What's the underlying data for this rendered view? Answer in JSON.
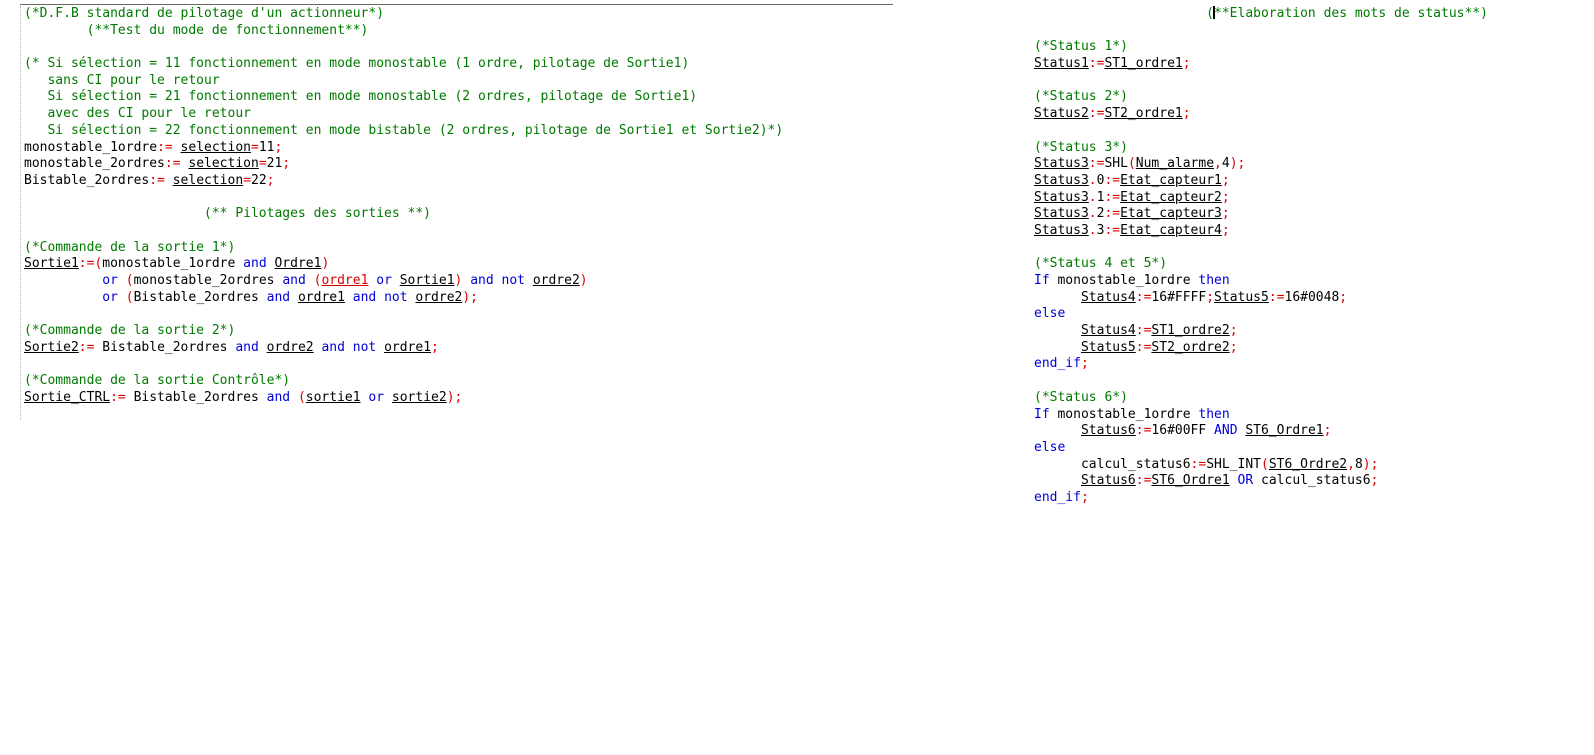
{
  "editor": {
    "name": "structured-text-editor",
    "panes": [
      {
        "id": "left",
        "title": "D.F.B standard de pilotage d'un actionneur"
      },
      {
        "id": "right",
        "title": "Elaboration des mots de status"
      }
    ],
    "colors": {
      "comment": "#007a00",
      "keyword": "#0000dd",
      "operator": "#dd0000",
      "identifier": "#000000",
      "background": "#ffffff",
      "rule": "#6b6b62",
      "gutter": "#b5b5b5"
    }
  },
  "left_pane": {
    "lines": [
      [
        {
          "t": "(*D.F.B standard de pilotage d'un actionneur*)",
          "c": "cm"
        }
      ],
      [
        {
          "t": "        (**Test du mode de fonctionnement**)",
          "c": "cm"
        }
      ],
      [
        {
          "t": "",
          "c": "id"
        }
      ],
      [
        {
          "t": "(* Si sélection = 11 fonctionnement en mode monostable (1 ordre, pilotage de Sortie1)",
          "c": "cm"
        }
      ],
      [
        {
          "t": "   sans CI pour le retour",
          "c": "cm"
        }
      ],
      [
        {
          "t": "   Si sélection = 21 fonctionnement en mode monostable (2 ordres, pilotage de Sortie1)",
          "c": "cm"
        }
      ],
      [
        {
          "t": "   avec des CI pour le retour",
          "c": "cm"
        }
      ],
      [
        {
          "t": "   Si sélection = 22 fonctionnement en mode bistable (2 ordres, pilotage de Sortie1 et Sortie2)*)",
          "c": "cm"
        }
      ],
      [
        {
          "t": "monostable_1ordre",
          "c": "id"
        },
        {
          "t": ":=",
          "c": "op"
        },
        {
          "t": " ",
          "c": "id"
        },
        {
          "t": "selection",
          "c": "v"
        },
        {
          "t": "=",
          "c": "op"
        },
        {
          "t": "11",
          "c": "id"
        },
        {
          "t": ";",
          "c": "op"
        }
      ],
      [
        {
          "t": "monostable_2ordres",
          "c": "id"
        },
        {
          "t": ":=",
          "c": "op"
        },
        {
          "t": " ",
          "c": "id"
        },
        {
          "t": "selection",
          "c": "v"
        },
        {
          "t": "=",
          "c": "op"
        },
        {
          "t": "21",
          "c": "id"
        },
        {
          "t": ";",
          "c": "op"
        }
      ],
      [
        {
          "t": "Bistable_2ordres",
          "c": "id"
        },
        {
          "t": ":=",
          "c": "op"
        },
        {
          "t": " ",
          "c": "id"
        },
        {
          "t": "selection",
          "c": "v"
        },
        {
          "t": "=",
          "c": "op"
        },
        {
          "t": "22",
          "c": "id"
        },
        {
          "t": ";",
          "c": "op"
        }
      ],
      [
        {
          "t": "",
          "c": "id"
        }
      ],
      [
        {
          "t": "                       (** Pilotages des sorties **)",
          "c": "cm"
        }
      ],
      [
        {
          "t": "",
          "c": "id"
        }
      ],
      [
        {
          "t": "(*Commande de la sortie 1*)",
          "c": "cm"
        }
      ],
      [
        {
          "t": "Sortie1",
          "c": "v"
        },
        {
          "t": ":=(",
          "c": "op"
        },
        {
          "t": "monostable_1ordre ",
          "c": "id"
        },
        {
          "t": "and",
          "c": "kw"
        },
        {
          "t": " ",
          "c": "id"
        },
        {
          "t": "Ordre1",
          "c": "v"
        },
        {
          "t": ")",
          "c": "op"
        }
      ],
      [
        {
          "t": "          ",
          "c": "id"
        },
        {
          "t": "or",
          "c": "kw"
        },
        {
          "t": " ",
          "c": "id"
        },
        {
          "t": "(",
          "c": "op"
        },
        {
          "t": "monostable_2ordres ",
          "c": "id"
        },
        {
          "t": "and",
          "c": "kw"
        },
        {
          "t": " ",
          "c": "id"
        },
        {
          "t": "(",
          "c": "op"
        },
        {
          "t": "ordre1",
          "c": "vr"
        },
        {
          "t": " ",
          "c": "id"
        },
        {
          "t": "or",
          "c": "kw"
        },
        {
          "t": " ",
          "c": "id"
        },
        {
          "t": "Sortie1",
          "c": "v"
        },
        {
          "t": ")",
          "c": "op"
        },
        {
          "t": " ",
          "c": "id"
        },
        {
          "t": "and not",
          "c": "kw"
        },
        {
          "t": " ",
          "c": "id"
        },
        {
          "t": "ordre2",
          "c": "v"
        },
        {
          "t": ")",
          "c": "op"
        }
      ],
      [
        {
          "t": "          ",
          "c": "id"
        },
        {
          "t": "or",
          "c": "kw"
        },
        {
          "t": " ",
          "c": "id"
        },
        {
          "t": "(",
          "c": "op"
        },
        {
          "t": "Bistable_2ordres ",
          "c": "id"
        },
        {
          "t": "and",
          "c": "kw"
        },
        {
          "t": " ",
          "c": "id"
        },
        {
          "t": "ordre1",
          "c": "v"
        },
        {
          "t": " ",
          "c": "id"
        },
        {
          "t": "and not",
          "c": "kw"
        },
        {
          "t": " ",
          "c": "id"
        },
        {
          "t": "ordre2",
          "c": "v"
        },
        {
          "t": ");",
          "c": "op"
        }
      ],
      [
        {
          "t": "",
          "c": "id"
        }
      ],
      [
        {
          "t": "(*Commande de la sortie 2*)",
          "c": "cm"
        }
      ],
      [
        {
          "t": "Sortie2",
          "c": "v"
        },
        {
          "t": ":=",
          "c": "op"
        },
        {
          "t": " Bistable_2ordres ",
          "c": "id"
        },
        {
          "t": "and",
          "c": "kw"
        },
        {
          "t": " ",
          "c": "id"
        },
        {
          "t": "ordre2",
          "c": "v"
        },
        {
          "t": " ",
          "c": "id"
        },
        {
          "t": "and not",
          "c": "kw"
        },
        {
          "t": " ",
          "c": "id"
        },
        {
          "t": "ordre1",
          "c": "v"
        },
        {
          "t": ";",
          "c": "op"
        }
      ],
      [
        {
          "t": "",
          "c": "id"
        }
      ],
      [
        {
          "t": "(*Commande de la sortie Contrôle*)",
          "c": "cm"
        }
      ],
      [
        {
          "t": "Sortie_CTRL",
          "c": "v"
        },
        {
          "t": ":=",
          "c": "op"
        },
        {
          "t": " Bistable_2ordres ",
          "c": "id"
        },
        {
          "t": "and",
          "c": "kw"
        },
        {
          "t": " ",
          "c": "id"
        },
        {
          "t": "(",
          "c": "op"
        },
        {
          "t": "sortie1",
          "c": "v"
        },
        {
          "t": " ",
          "c": "id"
        },
        {
          "t": "or",
          "c": "kw"
        },
        {
          "t": " ",
          "c": "id"
        },
        {
          "t": "sortie2",
          "c": "v"
        },
        {
          "t": ");",
          "c": "op"
        }
      ]
    ]
  },
  "right_pane": {
    "lines": [
      [
        {
          "t": "                      (",
          "c": "cm"
        },
        {
          "t": "",
          "c": "caret"
        },
        {
          "t": "**Elaboration des mots de status**)",
          "c": "cm"
        }
      ],
      [
        {
          "t": "",
          "c": "id"
        }
      ],
      [
        {
          "t": "(*Status 1*)",
          "c": "cm"
        }
      ],
      [
        {
          "t": "Status1",
          "c": "v"
        },
        {
          "t": ":=",
          "c": "op"
        },
        {
          "t": "ST1_ordre1",
          "c": "v"
        },
        {
          "t": ";",
          "c": "op"
        }
      ],
      [
        {
          "t": "",
          "c": "id"
        }
      ],
      [
        {
          "t": "(*Status 2*)",
          "c": "cm"
        }
      ],
      [
        {
          "t": "Status2",
          "c": "v"
        },
        {
          "t": ":=",
          "c": "op"
        },
        {
          "t": "ST2_ordre1",
          "c": "v"
        },
        {
          "t": ";",
          "c": "op"
        }
      ],
      [
        {
          "t": "",
          "c": "id"
        }
      ],
      [
        {
          "t": "(*Status 3*)",
          "c": "cm"
        }
      ],
      [
        {
          "t": "Status3",
          "c": "v"
        },
        {
          "t": ":=",
          "c": "op"
        },
        {
          "t": "SHL",
          "c": "id"
        },
        {
          "t": "(",
          "c": "op"
        },
        {
          "t": "Num_alarme",
          "c": "v"
        },
        {
          "t": ",",
          "c": "op"
        },
        {
          "t": "4",
          "c": "id"
        },
        {
          "t": ");",
          "c": "op"
        }
      ],
      [
        {
          "t": "Status3",
          "c": "v"
        },
        {
          "t": ".",
          "c": "op"
        },
        {
          "t": "0",
          "c": "id"
        },
        {
          "t": ":=",
          "c": "op"
        },
        {
          "t": "Etat_capteur1",
          "c": "v"
        },
        {
          "t": ";",
          "c": "op"
        }
      ],
      [
        {
          "t": "Status3",
          "c": "v"
        },
        {
          "t": ".",
          "c": "op"
        },
        {
          "t": "1",
          "c": "id"
        },
        {
          "t": ":=",
          "c": "op"
        },
        {
          "t": "Etat_capteur2",
          "c": "v"
        },
        {
          "t": ";",
          "c": "op"
        }
      ],
      [
        {
          "t": "Status3",
          "c": "v"
        },
        {
          "t": ".",
          "c": "op"
        },
        {
          "t": "2",
          "c": "id"
        },
        {
          "t": ":=",
          "c": "op"
        },
        {
          "t": "Etat_capteur3",
          "c": "v"
        },
        {
          "t": ";",
          "c": "op"
        }
      ],
      [
        {
          "t": "Status3",
          "c": "v"
        },
        {
          "t": ".",
          "c": "op"
        },
        {
          "t": "3",
          "c": "id"
        },
        {
          "t": ":=",
          "c": "op"
        },
        {
          "t": "Etat_capteur4",
          "c": "v"
        },
        {
          "t": ";",
          "c": "op"
        }
      ],
      [
        {
          "t": "",
          "c": "id"
        }
      ],
      [
        {
          "t": "(*Status 4 et 5*)",
          "c": "cm"
        }
      ],
      [
        {
          "t": "If",
          "c": "kw"
        },
        {
          "t": " monostable_1ordre ",
          "c": "id"
        },
        {
          "t": "then",
          "c": "kw"
        }
      ],
      [
        {
          "t": "      ",
          "c": "id"
        },
        {
          "t": "Status4",
          "c": "v"
        },
        {
          "t": ":=",
          "c": "op"
        },
        {
          "t": "16#FFFF",
          "c": "id"
        },
        {
          "t": ";",
          "c": "op"
        },
        {
          "t": "Status5",
          "c": "v"
        },
        {
          "t": ":=",
          "c": "op"
        },
        {
          "t": "16#0048",
          "c": "id"
        },
        {
          "t": ";",
          "c": "op"
        }
      ],
      [
        {
          "t": "else",
          "c": "kw"
        }
      ],
      [
        {
          "t": "      ",
          "c": "id"
        },
        {
          "t": "Status4",
          "c": "v"
        },
        {
          "t": ":=",
          "c": "op"
        },
        {
          "t": "ST1_ordre2",
          "c": "v"
        },
        {
          "t": ";",
          "c": "op"
        }
      ],
      [
        {
          "t": "      ",
          "c": "id"
        },
        {
          "t": "Status5",
          "c": "v"
        },
        {
          "t": ":=",
          "c": "op"
        },
        {
          "t": "ST2_ordre2",
          "c": "v"
        },
        {
          "t": ";",
          "c": "op"
        }
      ],
      [
        {
          "t": "end_if",
          "c": "kw"
        },
        {
          "t": ";",
          "c": "op"
        }
      ],
      [
        {
          "t": "",
          "c": "id"
        }
      ],
      [
        {
          "t": "(*Status 6*)",
          "c": "cm"
        }
      ],
      [
        {
          "t": "If",
          "c": "kw"
        },
        {
          "t": " monostable_1ordre ",
          "c": "id"
        },
        {
          "t": "then",
          "c": "kw"
        }
      ],
      [
        {
          "t": "      ",
          "c": "id"
        },
        {
          "t": "Status6",
          "c": "v"
        },
        {
          "t": ":=",
          "c": "op"
        },
        {
          "t": "16#00FF ",
          "c": "id"
        },
        {
          "t": "AND",
          "c": "kw"
        },
        {
          "t": " ",
          "c": "id"
        },
        {
          "t": "ST6_Ordre1",
          "c": "v"
        },
        {
          "t": ";",
          "c": "op"
        }
      ],
      [
        {
          "t": "else",
          "c": "kw"
        }
      ],
      [
        {
          "t": "      ",
          "c": "id"
        },
        {
          "t": "calcul_status6",
          "c": "id"
        },
        {
          "t": ":=",
          "c": "op"
        },
        {
          "t": "SHL_INT",
          "c": "id"
        },
        {
          "t": "(",
          "c": "op"
        },
        {
          "t": "ST6_Ordre2",
          "c": "v"
        },
        {
          "t": ",",
          "c": "op"
        },
        {
          "t": "8",
          "c": "id"
        },
        {
          "t": ");",
          "c": "op"
        }
      ],
      [
        {
          "t": "      ",
          "c": "id"
        },
        {
          "t": "Status6",
          "c": "v"
        },
        {
          "t": ":=",
          "c": "op"
        },
        {
          "t": "ST6_Ordre1",
          "c": "v"
        },
        {
          "t": " ",
          "c": "id"
        },
        {
          "t": "OR",
          "c": "kw"
        },
        {
          "t": " calcul_status6",
          "c": "id"
        },
        {
          "t": ";",
          "c": "op"
        }
      ],
      [
        {
          "t": "end_if",
          "c": "kw"
        },
        {
          "t": ";",
          "c": "op"
        }
      ]
    ]
  }
}
